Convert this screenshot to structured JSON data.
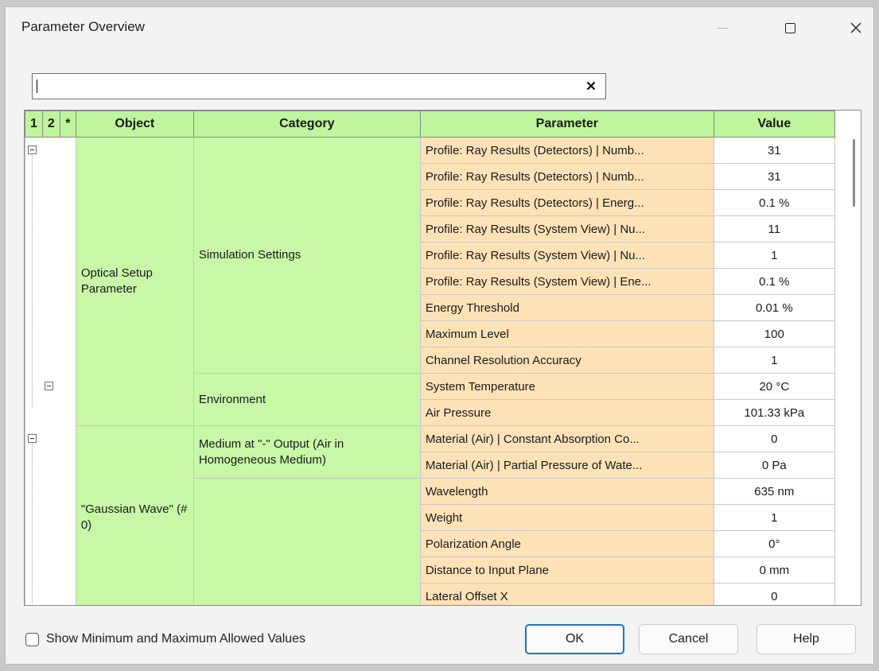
{
  "window": {
    "title": "Parameter Overview"
  },
  "search": {
    "value": "",
    "placeholder": ""
  },
  "grid": {
    "headers": {
      "lvl1": "1",
      "lvl2": "2",
      "lvl3": "*",
      "object": "Object",
      "category": "Category",
      "parameter": "Parameter",
      "value": "Value"
    },
    "objects": [
      "Optical Setup Parameter",
      "\"Gaussian Wave\" (# 0)"
    ],
    "categories": [
      "Simulation Settings",
      "Environment",
      "Medium at \"-\" Output (Air in Homogeneous Medium)",
      ""
    ],
    "rows": [
      {
        "parameter": "Profile: Ray Results (Detectors) | Numb...",
        "value": "31"
      },
      {
        "parameter": "Profile: Ray Results (Detectors) | Numb...",
        "value": "31"
      },
      {
        "parameter": "Profile: Ray Results (Detectors) | Energ...",
        "value": "0.1 %"
      },
      {
        "parameter": "Profile: Ray Results (System View) | Nu...",
        "value": "11"
      },
      {
        "parameter": "Profile: Ray Results (System View) | Nu...",
        "value": "1"
      },
      {
        "parameter": "Profile: Ray Results (System View) | Ene...",
        "value": "0.1 %"
      },
      {
        "parameter": "Energy Threshold",
        "value": "0.01 %"
      },
      {
        "parameter": "Maximum Level",
        "value": "100"
      },
      {
        "parameter": "Channel Resolution Accuracy",
        "value": "1"
      },
      {
        "parameter": "System Temperature",
        "value": "20 °C"
      },
      {
        "parameter": "Air Pressure",
        "value": "101.33 kPa"
      },
      {
        "parameter": "Material (Air) | Constant Absorption Co...",
        "value": "0"
      },
      {
        "parameter": "Material (Air) | Partial Pressure of Wate...",
        "value": "0 Pa"
      },
      {
        "parameter": "Wavelength",
        "value": "635 nm"
      },
      {
        "parameter": "Weight",
        "value": "1"
      },
      {
        "parameter": "Polarization Angle",
        "value": "0°"
      },
      {
        "parameter": "Distance to Input Plane",
        "value": "0 mm"
      },
      {
        "parameter": "Lateral Offset X",
        "value": "0"
      }
    ]
  },
  "footer": {
    "checkbox_label": "Show Minimum and Maximum Allowed Values",
    "ok_label": "OK",
    "cancel_label": "Cancel",
    "help_label": "Help"
  }
}
